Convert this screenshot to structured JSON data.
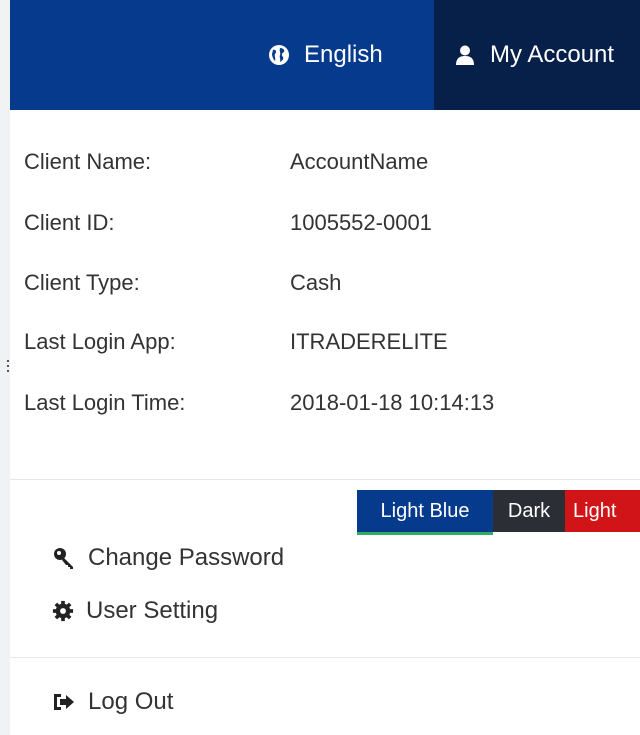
{
  "header": {
    "language_label": "English",
    "account_label": "My Account",
    "colors": {
      "bar": "#063a8c",
      "active": "#07204a"
    }
  },
  "client_info": {
    "rows": [
      {
        "label": "Client Name:",
        "value": "AccountName"
      },
      {
        "label": "Client ID:",
        "value": "1005552-0001"
      },
      {
        "label": "Client Type:",
        "value": "Cash"
      },
      {
        "label": "Last Login App:",
        "value": "ITRADERELITE"
      },
      {
        "label": "Last Login Time:",
        "value": "2018-01-18 10:14:13"
      }
    ]
  },
  "themes": {
    "options": [
      {
        "label": "Light Blue",
        "color": "#063a8c",
        "selected": true
      },
      {
        "label": "Dark",
        "color": "#2b2f35",
        "selected": false
      },
      {
        "label": "Light",
        "color": "#d01418",
        "selected": false
      }
    ]
  },
  "menu": {
    "change_password": {
      "label": "Change Password",
      "icon": "key-icon"
    },
    "user_setting": {
      "label": "User Setting",
      "icon": "gear-icon"
    },
    "log_out": {
      "label": "Log Out",
      "icon": "sign-out-icon"
    }
  }
}
